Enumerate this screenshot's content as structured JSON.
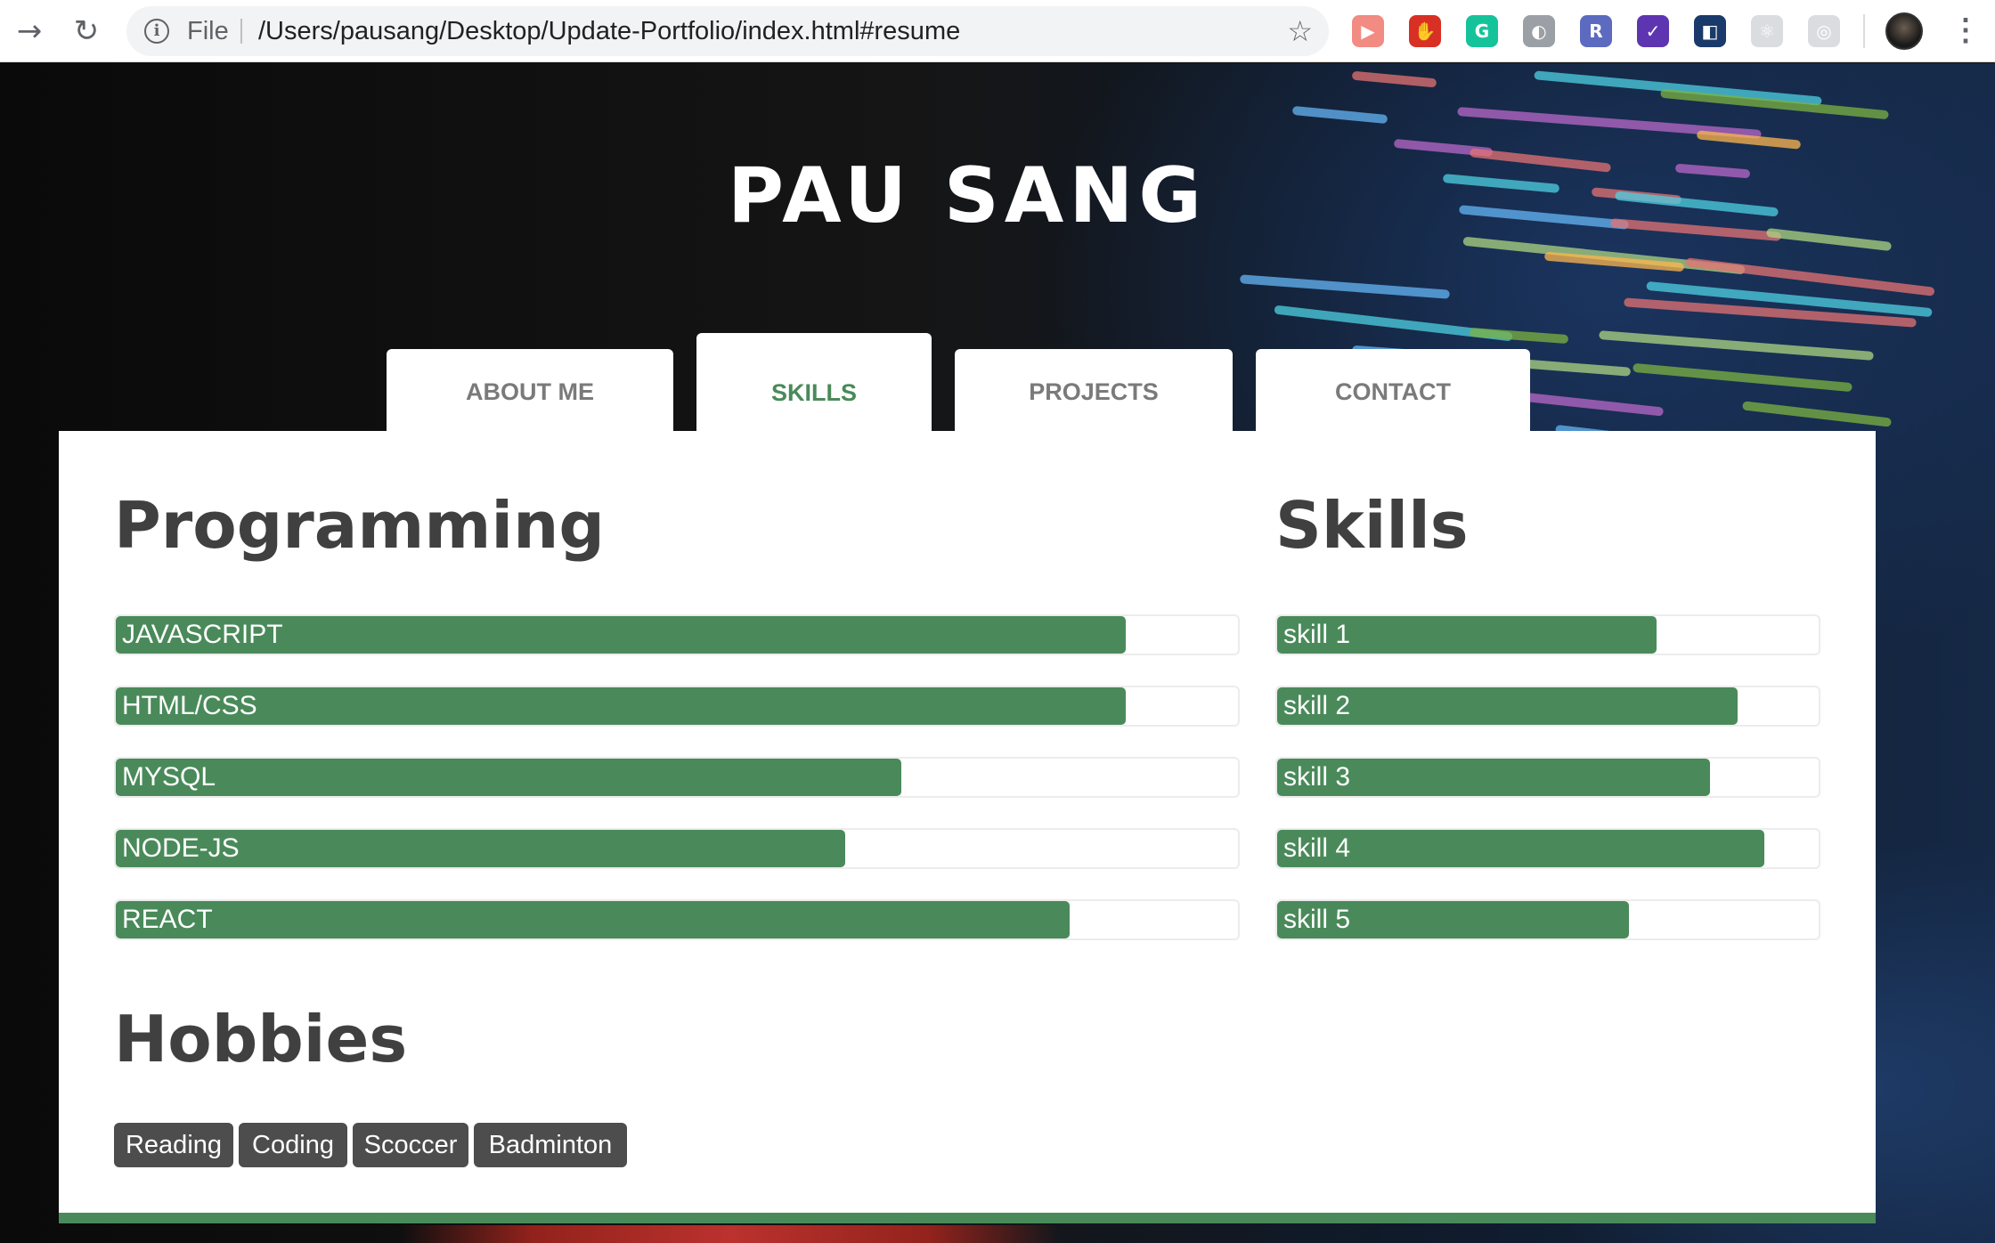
{
  "browser": {
    "file_label": "File",
    "url": "/Users/pausang/Desktop/Update-Portfolio/index.html#resume",
    "back_glyph": "→",
    "reload_glyph": "↻",
    "info_glyph": "i",
    "star_glyph": "☆",
    "menu_glyph": "⋮",
    "extensions": [
      {
        "name": "screencast-icon",
        "color": "#f28b82",
        "glyph": "▶"
      },
      {
        "name": "adblock-icon",
        "color": "#d93025",
        "glyph": "✋"
      },
      {
        "name": "grammarly-icon",
        "color": "#15c39a",
        "glyph": "G"
      },
      {
        "name": "halo-icon",
        "color": "#9aa0a6",
        "glyph": "◐"
      },
      {
        "name": "r-extension-icon",
        "color": "#5c6bc0",
        "glyph": "R"
      },
      {
        "name": "check-extension-icon",
        "color": "#5e35b1",
        "glyph": "✓"
      },
      {
        "name": "ms-extension-icon",
        "color": "#1a3a6b",
        "glyph": "◧"
      },
      {
        "name": "react-devtools-icon",
        "color": "#dadce0",
        "glyph": "⚛"
      },
      {
        "name": "target-extension-icon",
        "color": "#dadce0",
        "glyph": "◎"
      }
    ]
  },
  "site": {
    "title": "PAU SANG"
  },
  "tabs": [
    {
      "id": "about",
      "label": "ABOUT ME"
    },
    {
      "id": "skills",
      "label": "SKILLS",
      "active": true
    },
    {
      "id": "projects",
      "label": "PROJECTS"
    },
    {
      "id": "contact",
      "label": "CONTACT"
    }
  ],
  "programming": {
    "title": "Programming",
    "items": [
      {
        "label": "JAVASCRIPT",
        "level": 0.9
      },
      {
        "label": "HTML/CSS",
        "level": 0.9
      },
      {
        "label": "MYSQL",
        "level": 0.7
      },
      {
        "label": "NODE-JS",
        "level": 0.65
      },
      {
        "label": "REACT",
        "level": 0.85
      }
    ]
  },
  "skills": {
    "title": "Skills",
    "items": [
      {
        "label": "skill 1",
        "level": 0.7
      },
      {
        "label": "skill 2",
        "level": 0.85
      },
      {
        "label": "skill 3",
        "level": 0.8
      },
      {
        "label": "skill 4",
        "level": 0.9
      },
      {
        "label": "skill 5",
        "level": 0.65
      }
    ]
  },
  "hobbies": {
    "title": "Hobbies",
    "items": [
      "Reading",
      "Coding",
      "Scoccer",
      "Badminton"
    ]
  },
  "colors": {
    "accent": "#4a8a5a",
    "heading": "#404040",
    "tag_bg": "#4d4d4d"
  }
}
